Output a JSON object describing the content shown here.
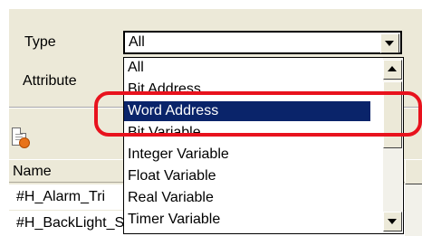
{
  "labels": {
    "type": "Type",
    "attribute": "Attribute"
  },
  "type_combo": {
    "value": "All"
  },
  "dropdown": {
    "options": [
      "All",
      "Bit Address",
      "Word Address",
      "Bit Variable",
      "Integer Variable",
      "Float Variable",
      "Real Variable",
      "Timer Variable"
    ],
    "selected_index": 2
  },
  "table": {
    "header_label": "Name",
    "rows": [
      "#H_Alarm_Tri",
      "#H_BackLight_System Variable"
    ]
  },
  "icons": {
    "document": "document-icon",
    "dropdown_arrow": "chevron-down-icon",
    "scroll_up": "chevron-up-icon"
  },
  "colors": {
    "selection": "#0a246a",
    "highlight": "#e8121d",
    "panel": "#ece9d8"
  }
}
